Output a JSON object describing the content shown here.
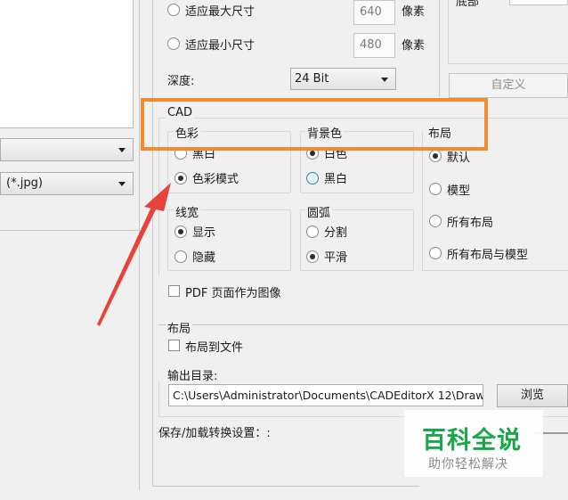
{
  "size_options": {
    "fit_max": {
      "label": "适应最大尺寸",
      "value": "640",
      "unit": "像素"
    },
    "fit_min": {
      "label": "适应最小尺寸",
      "value": "480",
      "unit": "像素"
    }
  },
  "depth": {
    "label": "深度:",
    "value": "24 Bit"
  },
  "bottom_partial_label": "底部",
  "custom_button": "自定义",
  "left_panel": {
    "format_value": "(*.jpg)"
  },
  "cad": {
    "title": "CAD",
    "color": {
      "title": "色彩",
      "options": [
        "黑白",
        "色彩模式"
      ],
      "selected": 1
    },
    "background": {
      "title": "背景色",
      "options": [
        "白色",
        "黑白"
      ],
      "selected": 0
    },
    "layout": {
      "title": "布局",
      "options": [
        "默认",
        "模型",
        "所有布局",
        "所有布局与模型"
      ],
      "selected": 0
    },
    "line_width": {
      "title": "线宽",
      "options": [
        "显示",
        "隐藏"
      ],
      "selected": 0
    },
    "arc": {
      "title": "圆弧",
      "options": [
        "分割",
        "平滑"
      ],
      "selected": 1
    },
    "pdf_as_image": {
      "label": "PDF 页面作为图像",
      "checked": false
    }
  },
  "layout_section": {
    "title": "布局",
    "layout_to_file": {
      "label": "布局到文件",
      "checked": false
    }
  },
  "output": {
    "label": "输出目录:",
    "path": "C:\\Users\\Administrator\\Documents\\CADEditorX 12\\Draw",
    "browse": "浏览"
  },
  "save_settings_label": "保存/加载转换设置：:",
  "watermark": {
    "title": "百科全说",
    "subtitle": "助你轻松解决"
  },
  "colors": {
    "highlight": "#f28a30",
    "arrow": "#e8433a",
    "watermark_green": "#18a84a"
  }
}
